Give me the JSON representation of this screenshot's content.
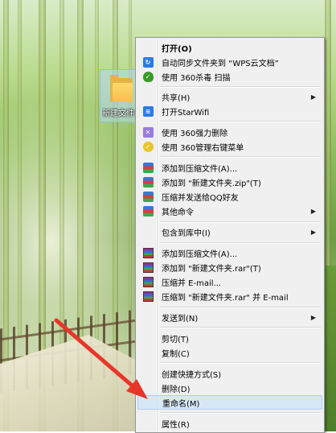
{
  "desktop": {
    "folder_label": "新建文件夹"
  },
  "menu": {
    "items": [
      {
        "label": "打开(O)",
        "bold": true
      },
      {
        "label": "自动同步文件夹到 “WPS云文档”",
        "icon": "wps-sync-icon"
      },
      {
        "label": "使用 360杀毒 扫描",
        "icon": "360-antivirus-icon"
      },
      {
        "label": "共享(H)",
        "submenu": true
      },
      {
        "label": "打开StarWifi",
        "icon": "wifi-icon"
      },
      {
        "label": "使用 360强力删除",
        "icon": "360-delete-icon"
      },
      {
        "label": "使用 360管理右键菜单",
        "icon": "360-manager-icon"
      },
      {
        "label": "添加到压缩文件(A)...",
        "icon": "zip-icon"
      },
      {
        "label": "添加到 \"新建文件夹.zip\"(T)",
        "icon": "zip-icon"
      },
      {
        "label": "压缩并发送给QQ好友",
        "icon": "zip-icon"
      },
      {
        "label": "其他命令",
        "icon": "zip-icon",
        "submenu": true
      },
      {
        "label": "包含到库中(I)",
        "submenu": true
      },
      {
        "label": "添加到压缩文件(A)...",
        "icon": "winrar-icon"
      },
      {
        "label": "添加到 \"新建文件夹.rar\"(T)",
        "icon": "winrar-icon"
      },
      {
        "label": "压缩并 E-mail...",
        "icon": "winrar-icon"
      },
      {
        "label": "压缩到 \"新建文件夹.rar\" 并 E-mail",
        "icon": "winrar-icon"
      },
      {
        "label": "发送到(N)",
        "submenu": true
      },
      {
        "label": "剪切(T)"
      },
      {
        "label": "复制(C)"
      },
      {
        "label": "创建快捷方式(S)"
      },
      {
        "label": "删除(D)"
      },
      {
        "label": "重命名(M)",
        "highlighted": true
      },
      {
        "label": "属性(R)"
      }
    ],
    "submenu_arrow": "▶"
  },
  "colors": {
    "menu_bg": "#f0f0f0",
    "highlight": "#c8e1fa",
    "annotation_arrow": "#e8352a"
  }
}
